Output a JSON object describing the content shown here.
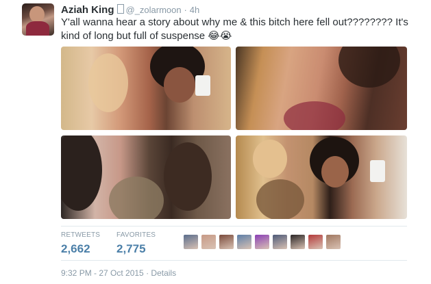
{
  "tweet": {
    "author_name": "Aziah King",
    "handle": "@_zolarmoon",
    "separator": "·",
    "time_ago": "4h",
    "text": "Y'all wanna hear a story about why me & this bitch here fell out???????? It's kind of long but full of suspense 😂😭"
  },
  "stats": {
    "retweets_label": "RETWEETS",
    "retweets_count": "2,662",
    "favorites_label": "FAVORITES",
    "favorites_count": "2,775"
  },
  "footer": {
    "timestamp": "9:32 PM - 27 Oct 2015",
    "separator": "·",
    "details_label": "Details"
  },
  "favoriters": [
    {
      "icon": "user-avatar",
      "color": "#5a6d8c"
    },
    {
      "icon": "user-avatar",
      "color": "#c79a86"
    },
    {
      "icon": "user-avatar",
      "color": "#7a4b3c"
    },
    {
      "icon": "user-avatar",
      "color": "#5d7fa8"
    },
    {
      "icon": "user-avatar",
      "color": "#8a3fb5"
    },
    {
      "icon": "user-avatar",
      "color": "#4d5a78"
    },
    {
      "icon": "user-avatar",
      "color": "#2a2626"
    },
    {
      "icon": "user-avatar",
      "color": "#b33a3a"
    },
    {
      "icon": "user-avatar",
      "color": "#a07760"
    }
  ],
  "colors": {
    "name": "#292f33",
    "secondary": "#8899a6",
    "count": "#4b7fa8",
    "divider": "#e1e8ed"
  }
}
